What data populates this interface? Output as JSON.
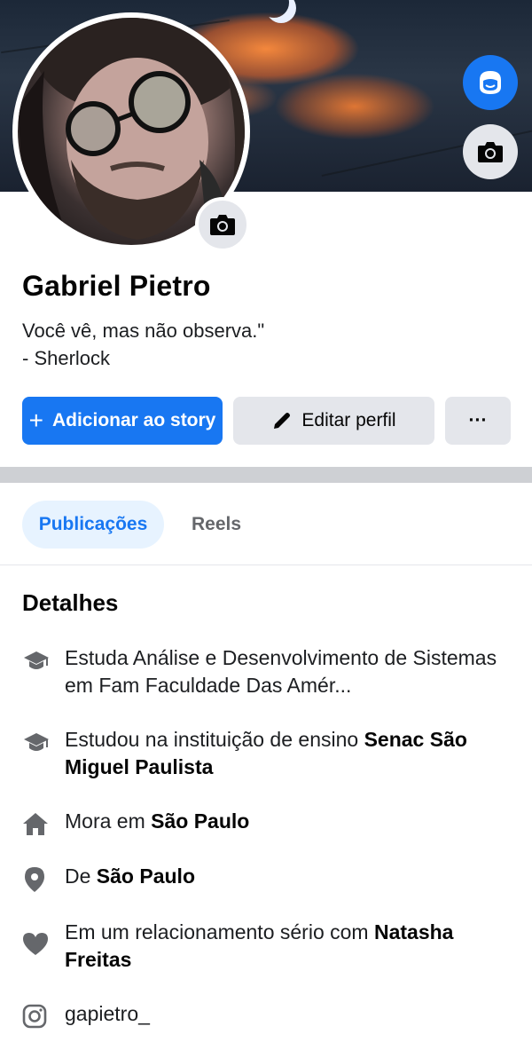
{
  "profile": {
    "name": "Gabriel Pietro",
    "bio_line1": "Você vê, mas não observa.\"",
    "bio_line2": "- Sherlock"
  },
  "actions": {
    "add_story_label": "Adicionar ao story",
    "edit_profile_label": "Editar perfil",
    "more_label": "···"
  },
  "tabs": [
    {
      "label": "Publicações",
      "active": true
    },
    {
      "label": "Reels",
      "active": false
    }
  ],
  "details": {
    "title": "Detalhes",
    "items": [
      {
        "icon": "graduation-cap-icon",
        "text": "Estuda Análise e Desenvolvimento de Sistemas em Fam Faculdade Das Amér...",
        "bold": ""
      },
      {
        "icon": "graduation-cap-icon",
        "text": "Estudou na instituição de ensino ",
        "bold": "Senac São Miguel Paulista"
      },
      {
        "icon": "home-icon",
        "text": "Mora em ",
        "bold": "São Paulo"
      },
      {
        "icon": "location-pin-icon",
        "text": "De ",
        "bold": "São Paulo"
      },
      {
        "icon": "heart-icon",
        "text": "Em um relacionamento sério com ",
        "bold": "Natasha Freitas"
      },
      {
        "icon": "instagram-icon",
        "text": "gapietro_",
        "bold": ""
      }
    ]
  },
  "colors": {
    "accent": "#1877f2",
    "button_gray": "#e4e6eb",
    "tab_active_bg": "#e7f3ff",
    "icon_gray": "#65676b"
  }
}
